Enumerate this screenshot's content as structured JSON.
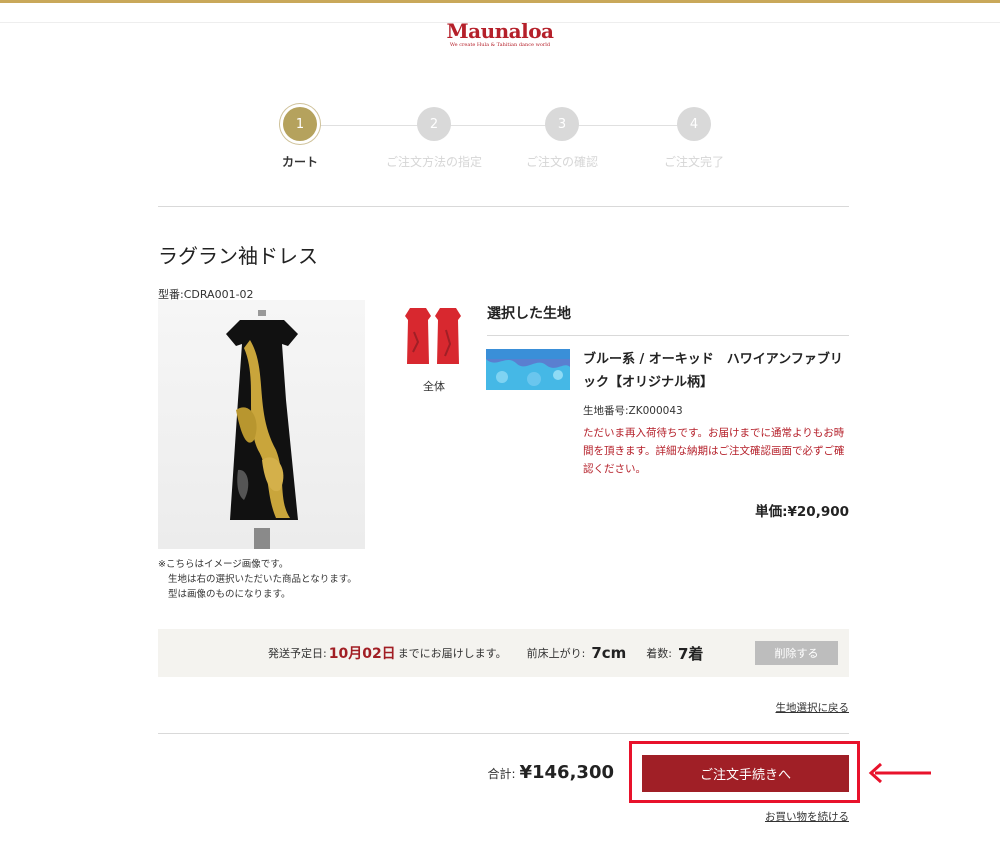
{
  "header": {
    "logo_text": "Maunaloa",
    "logo_tagline": "We create Hula & Tahitian dance world",
    "brand_color": "#b5202a",
    "accent_color": "#c9a85a"
  },
  "steps": [
    {
      "number": "1",
      "label": "カート",
      "active": true
    },
    {
      "number": "2",
      "label": "ご注文方法の指定",
      "active": false
    },
    {
      "number": "3",
      "label": "ご注文の確認",
      "active": false
    },
    {
      "number": "4",
      "label": "ご注文完了",
      "active": false
    }
  ],
  "product": {
    "title": "ラグラン袖ドレス",
    "model_number": "型番:CDRA001-02",
    "image_icon": "dress-photo",
    "note_lines": [
      "※こちらはイメージ画像です。",
      "生地は右の選択いただいた商品となります。",
      "型は画像のものになります。"
    ],
    "thumbnail_label": "全体"
  },
  "selected_fabric": {
    "heading": "選択した生地",
    "name": "ブルー系 / オーキッド　ハワイアンファブリック【オリジナル柄】",
    "fabric_number": "生地番号:ZK000043",
    "warning": "ただいま再入荷待ちです。お届けまでに通常よりもお時間を頂きます。詳細な納期はご注文確認画面で必ずご確認ください。",
    "warning_color": "#b5202a",
    "unit_price": "単価:¥20,900"
  },
  "shipping": {
    "prefix": "発送予定日:",
    "date": "10月02日",
    "suffix": "までにお届けします。",
    "hem_label": "前床上がり:",
    "hem_value": "7cm",
    "qty_label": "着数:",
    "qty_value": "7着",
    "delete_label": "削除する"
  },
  "links": {
    "back_to_fabric": "生地選択に戻る",
    "continue_shopping": "お買い物を続ける"
  },
  "summary": {
    "total_label": "合計:",
    "total_value": "¥146,300",
    "checkout_label": "ご注文手続きへ",
    "checkout_color": "#a01f26",
    "highlight_color": "#e8122b"
  }
}
